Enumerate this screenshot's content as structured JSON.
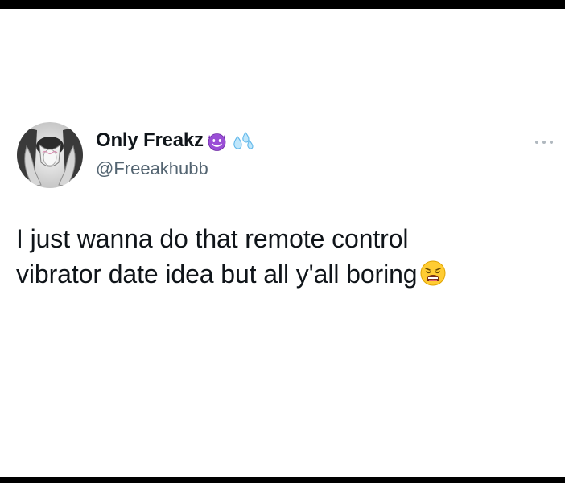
{
  "tweet": {
    "author": {
      "display_name": "Only Freakz",
      "handle": "@Freeakhubb",
      "avatar_icon": "avatar-tongue-out-photo",
      "name_emojis": [
        "smiling-devil-emoji",
        "sweat-droplets-emoji"
      ]
    },
    "text_lines": [
      "I just wanna do that remote control",
      "vibrator date idea but all y'all boring"
    ],
    "text_emoji": "weary-face-emoji",
    "more_icon": "ellipsis-icon"
  },
  "colors": {
    "background": "#ffffff",
    "frame_bars": "#000000",
    "text_primary": "#0f1419",
    "text_secondary": "#536471",
    "devil_purple": "#8a3ec4"
  }
}
